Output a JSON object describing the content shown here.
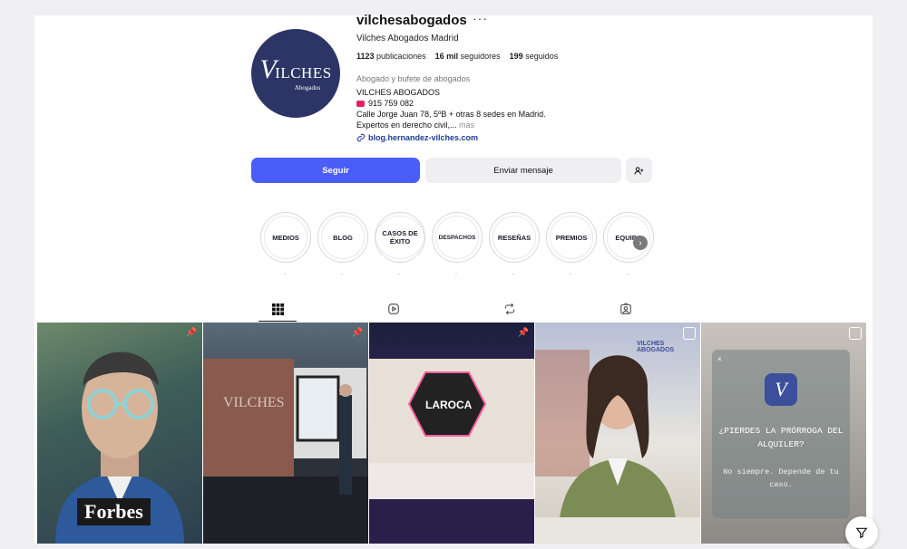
{
  "profile": {
    "username": "vilchesabogados",
    "more": "···",
    "full_name": "Vilches Abogados Madrid",
    "stats": {
      "posts_count": "1123",
      "posts_label": "publicaciones",
      "followers_count": "16 mil",
      "followers_label": "seguidores",
      "following_count": "199",
      "following_label": "seguidos"
    },
    "category": "Abogado y bufete de abogados",
    "bio": {
      "line1": "VILCHES ABOGADOS",
      "phone": "915 759 082",
      "line3": "Calle Jorge Juan 78, 5ºB + otras 8 sedes en Madrid.",
      "line4": "Expertos en derecho civil,...",
      "more": "más"
    },
    "link": "blog.hernandez-vilches.com",
    "avatar": {
      "logo_initial": "V",
      "logo_text": "ILCHES",
      "logo_sub": "Abogados"
    }
  },
  "actions": {
    "follow": "Seguir",
    "message": "Enviar mensaje"
  },
  "highlights": [
    {
      "label": "MEDIOS"
    },
    {
      "label": "BLOG"
    },
    {
      "label": "CASOS DE ÉXITO"
    },
    {
      "label": "DESPACHOS"
    },
    {
      "label": "RESEÑAS"
    },
    {
      "label": "PREMIOS"
    },
    {
      "label": "EQUIPO"
    }
  ],
  "highlight_dot": ".",
  "tabs": [
    {
      "icon": "grid-icon"
    },
    {
      "icon": "reels-icon"
    },
    {
      "icon": "reposts-icon"
    },
    {
      "icon": "tagged-icon"
    }
  ],
  "posts": {
    "p1_text": "Forbes",
    "p2_text": "VILCHES",
    "p3_text": "LAROCA",
    "p4_text": "VILCHES ABOGADOS",
    "p5_question": "¿PIERDES LA PRÓRROGA DEL ALQUILER?",
    "p5_answer": "No siempre. Depende de tu caso.",
    "p5_logo": "V"
  },
  "colors": {
    "accent": "#4a5df9",
    "avatar_bg": "#2c3566",
    "link": "#1d3c96"
  }
}
